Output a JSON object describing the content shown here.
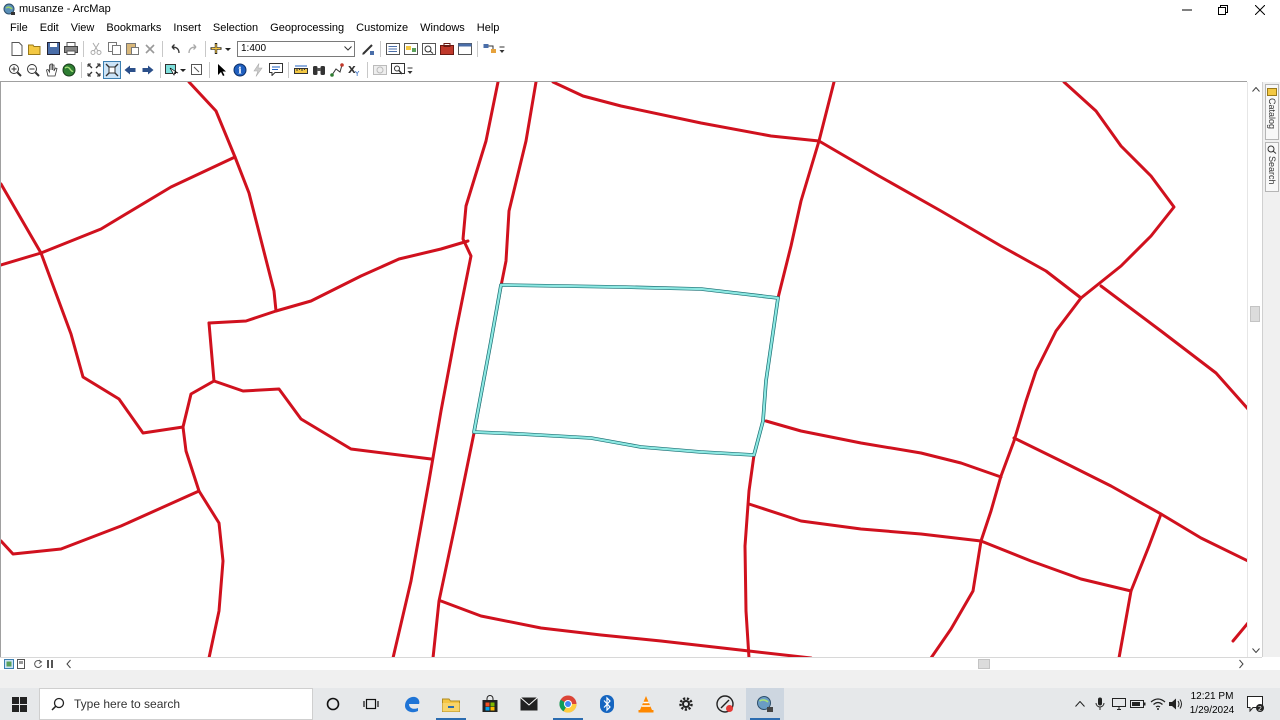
{
  "window": {
    "title": "musanze - ArcMap",
    "controls": [
      "minimize",
      "maximize",
      "close"
    ]
  },
  "menu": [
    "File",
    "Edit",
    "View",
    "Bookmarks",
    "Insert",
    "Selection",
    "Geoprocessing",
    "Customize",
    "Windows",
    "Help"
  ],
  "standard_toolbar": {
    "scale": "1:400"
  },
  "tools_toolbar": {
    "active_tool": "full-extent"
  },
  "side_tabs": [
    "Catalog",
    "Search"
  ],
  "map": {
    "line_color": "#d0111e",
    "selection_color": "#7ee0dc",
    "selected_feature_count": 1
  },
  "taskbar": {
    "search_placeholder": "Type here to search",
    "apps": [
      "cortana",
      "task-view",
      "edge",
      "file-explorer",
      "store",
      "mail",
      "chrome",
      "bluetooth",
      "vlc",
      "settings",
      "screen-recorder",
      "arcmap"
    ],
    "tray_icons": [
      "show-hidden",
      "microphone",
      "display",
      "battery",
      "wifi",
      "volume"
    ],
    "time": "12:21 PM",
    "date": "1/29/2024",
    "notification_count": "2"
  }
}
